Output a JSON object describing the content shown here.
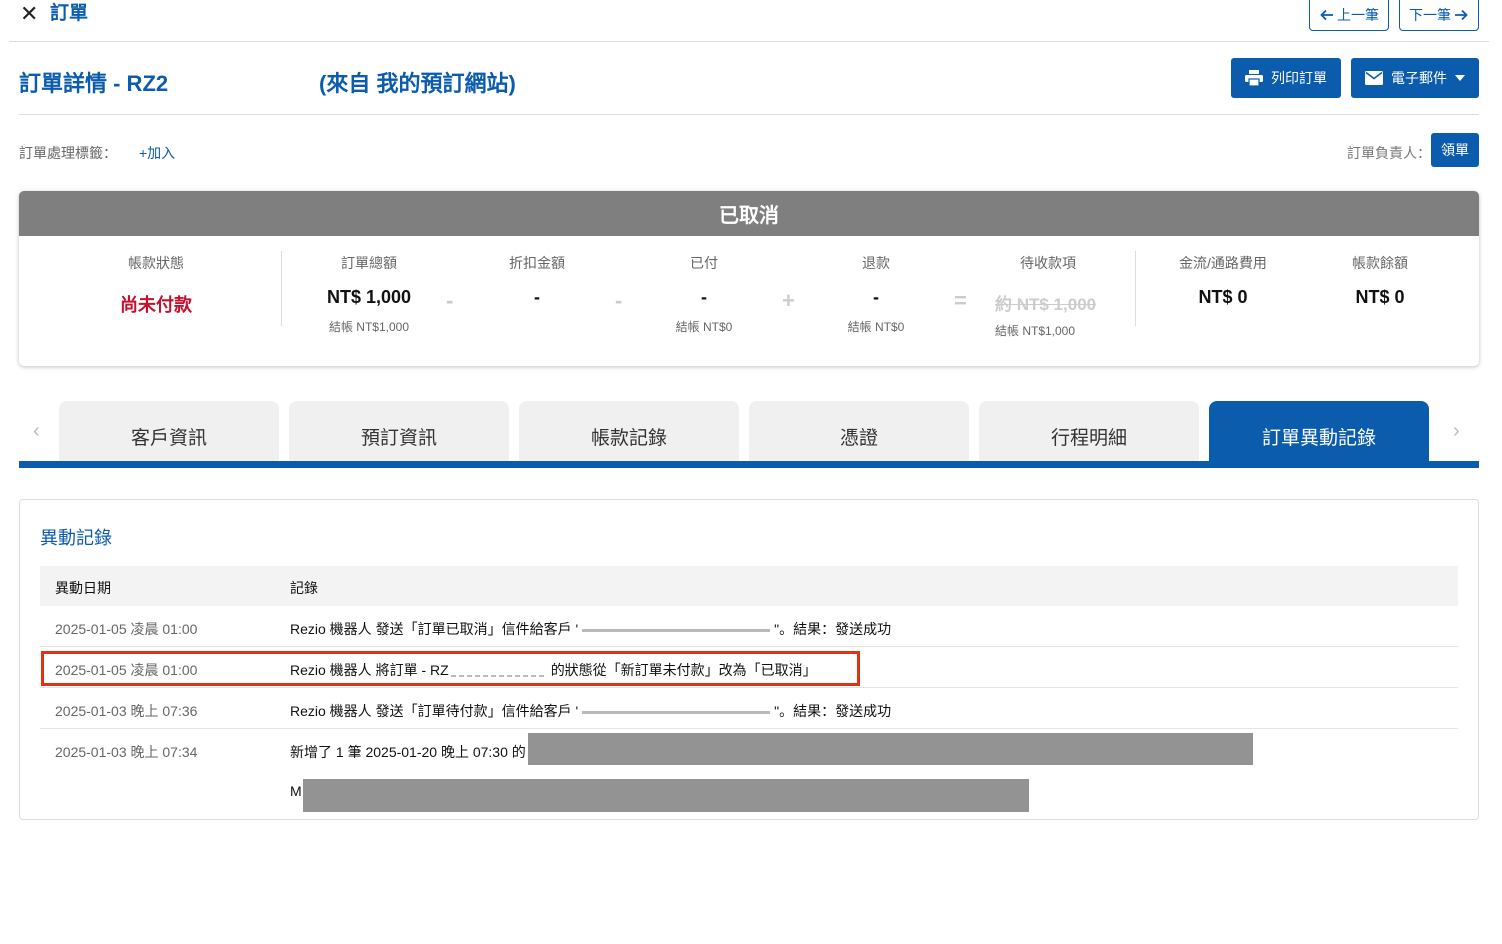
{
  "header": {
    "close_glyph": "✕",
    "breadcrumb": "訂單",
    "prev_label": "上一筆",
    "next_label": "下一筆"
  },
  "order": {
    "title": "訂單詳情  - RZ2",
    "source": "(來自 我的預訂網站)",
    "print_label": "列印訂單",
    "email_label": "電子郵件",
    "tags_label": "訂單處理標籤：",
    "tags_add": "+加入",
    "owner_label": "訂單負責人：",
    "claim_label": "領單"
  },
  "status": {
    "banner": "已取消",
    "account_status_label": "帳款狀態",
    "account_status_value": "尚未付款",
    "total_label": "訂單總額",
    "total_value": "NT$ 1,000",
    "total_sub": "結帳 NT$1,000",
    "discount_label": "折扣金額",
    "discount_value": "-",
    "paid_label": "已付",
    "paid_value": "-",
    "paid_sub": "結帳 NT$0",
    "refund_label": "退款",
    "refund_value": "-",
    "refund_sub": "結帳 NT$0",
    "receivable_label": "待收款項",
    "receivable_value": "約 NT$ 1,000",
    "receivable_sub": "結帳 NT$1,000",
    "fee_label": "金流/通路費用",
    "fee_value": "NT$ 0",
    "balance_label": "帳款餘額",
    "balance_value": "NT$ 0",
    "ops": [
      "-",
      "-",
      "+",
      "="
    ],
    "colors": {
      "unpaid": "#c8102e",
      "banner": "#7f7f7f"
    }
  },
  "tabs": {
    "items": [
      "客戶資訊",
      "預訂資訊",
      "帳款記錄",
      "憑證",
      "行程明細",
      "訂單異動記錄"
    ],
    "active_index": 5,
    "prev_arrow": "‹",
    "next_arrow": "›"
  },
  "log": {
    "title": "異動記錄",
    "columns": [
      "異動日期",
      "記錄"
    ],
    "rows": [
      {
        "date": "2025-01-05 凌晨 01:00",
        "pre": "Rezio 機器人 發送「訂單已取消」信件給客戶 '",
        "post": "\"。結果：發送成功"
      },
      {
        "date": "2025-01-05 凌晨 01:00",
        "pre": "Rezio 機器人 將訂單 - RZ",
        "post": "的狀態從「新訂單未付款」改為「已取消」"
      },
      {
        "date": "2025-01-03 晚上 07:36",
        "pre": "Rezio 機器人 發送「訂單待付款」信件給客戶 '",
        "post": "\"。結果：發送成功"
      },
      {
        "date": "2025-01-03 晚上 07:34",
        "pre": "新增了 1 筆 2025-01-20 晚上 07:30 的",
        "post": ""
      }
    ],
    "last_line_prefix": "M",
    "accent": "#0b5cad",
    "highlight_color": "#e53018"
  }
}
